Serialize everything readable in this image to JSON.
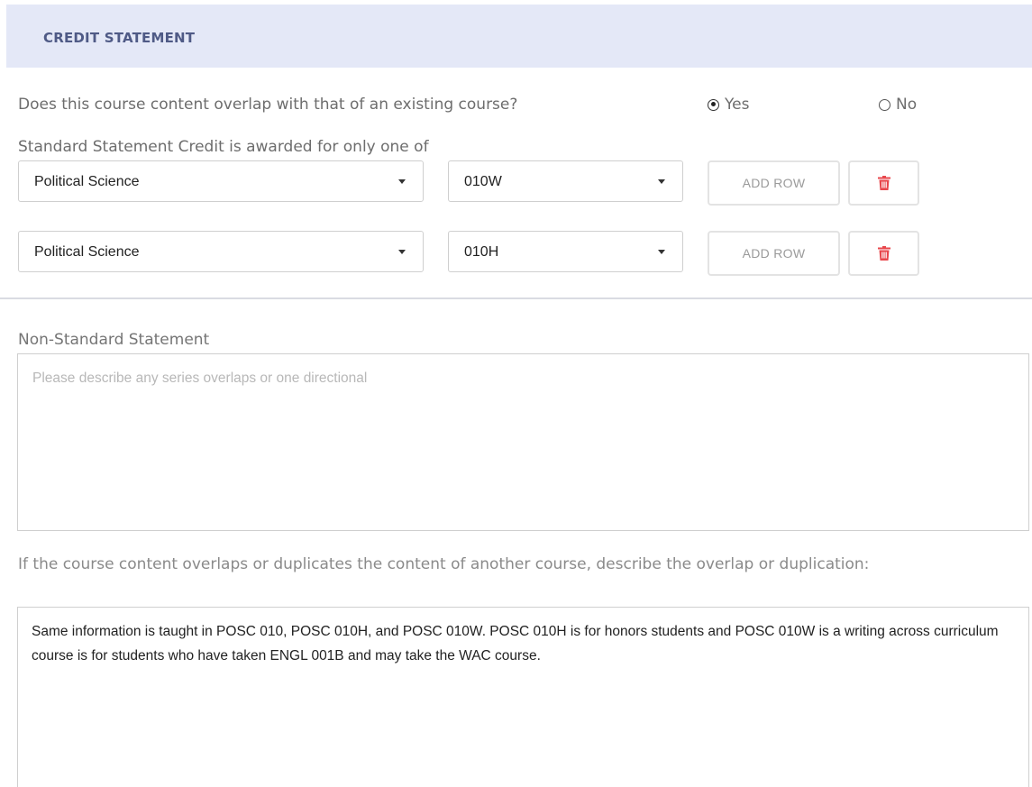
{
  "section": {
    "title": "CREDIT STATEMENT"
  },
  "overlap_question": {
    "label": "Does this course content overlap with that of an existing course?",
    "options": [
      {
        "label": "Yes",
        "selected": true
      },
      {
        "label": "No",
        "selected": false
      }
    ]
  },
  "standard_statement": {
    "label": "Standard Statement Credit is awarded for only one of",
    "rows": [
      {
        "subject": "Political Science",
        "course": "010W",
        "add_label": "ADD ROW"
      },
      {
        "subject": "Political Science",
        "course": "010H",
        "add_label": "ADD ROW"
      }
    ]
  },
  "non_standard": {
    "label": "Non-Standard Statement",
    "placeholder": "Please describe any series overlaps or one directional",
    "value": ""
  },
  "overlap_description": {
    "label": "If the course content overlaps or duplicates the content of another course, describe the overlap or duplication:",
    "value": "Same information is taught in POSC 010, POSC 010H, and POSC 010W. POSC 010H is for honors students and POSC 010W is a writing across curriculum course is for students who have taken ENGL 001B and may take the WAC course."
  },
  "colors": {
    "header_bg": "#e4e8f7",
    "header_text": "#4f5a86",
    "delete_icon": "#e8474c"
  },
  "icons": {
    "delete": "trash-icon",
    "dropdown": "caret-down-icon",
    "radio": "radio-icon"
  }
}
